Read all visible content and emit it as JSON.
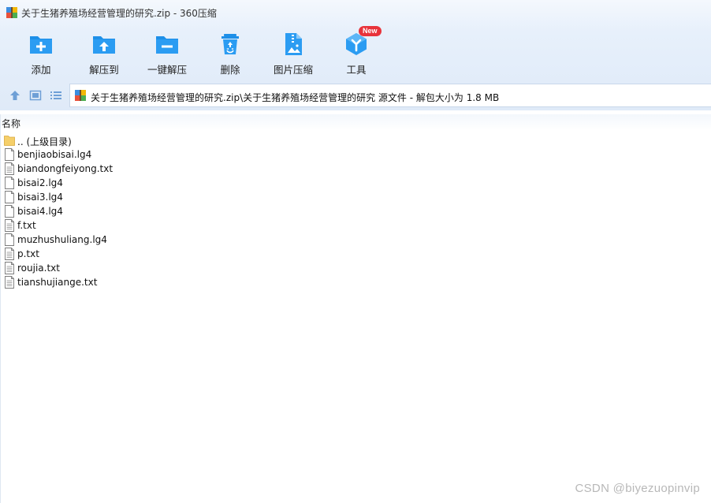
{
  "window": {
    "title": "关于生猪养殖场经营管理的研究.zip - 360压缩"
  },
  "toolbar": {
    "buttons": [
      {
        "label": "添加",
        "icon": "add-folder-icon"
      },
      {
        "label": "解压到",
        "icon": "extract-to-icon"
      },
      {
        "label": "一键解压",
        "icon": "one-click-extract-icon"
      },
      {
        "label": "删除",
        "icon": "recycle-bin-icon"
      },
      {
        "label": "图片压缩",
        "icon": "image-compress-icon"
      },
      {
        "label": "工具",
        "icon": "tools-cube-icon"
      }
    ],
    "tools_badge": "New"
  },
  "navbar": {
    "path": "关于生猪养殖场经营管理的研究.zip\\关于生猪养殖场经营管理的研究 源文件 - 解包大小为 1.8 MB"
  },
  "file_list": {
    "column_name": "名称",
    "files": [
      {
        "name": ".. (上级目录)",
        "icon": "folder-icon"
      },
      {
        "name": "benjiaobisai.lg4",
        "icon": "blank-file-icon"
      },
      {
        "name": "biandongfeiyong.txt",
        "icon": "text-file-icon"
      },
      {
        "name": "bisai2.lg4",
        "icon": "blank-file-icon"
      },
      {
        "name": "bisai3.lg4",
        "icon": "blank-file-icon"
      },
      {
        "name": "bisai4.lg4",
        "icon": "blank-file-icon"
      },
      {
        "name": "f.txt",
        "icon": "text-file-icon"
      },
      {
        "name": "muzhushuliang.lg4",
        "icon": "blank-file-icon"
      },
      {
        "name": "p.txt",
        "icon": "text-file-icon"
      },
      {
        "name": "roujia.txt",
        "icon": "text-file-icon"
      },
      {
        "name": "tianshujiange.txt",
        "icon": "text-file-icon"
      }
    ]
  },
  "watermark": "CSDN @biyezuopinvip",
  "colors": {
    "accent": "#1d8fe8",
    "badge": "#e8333b"
  }
}
